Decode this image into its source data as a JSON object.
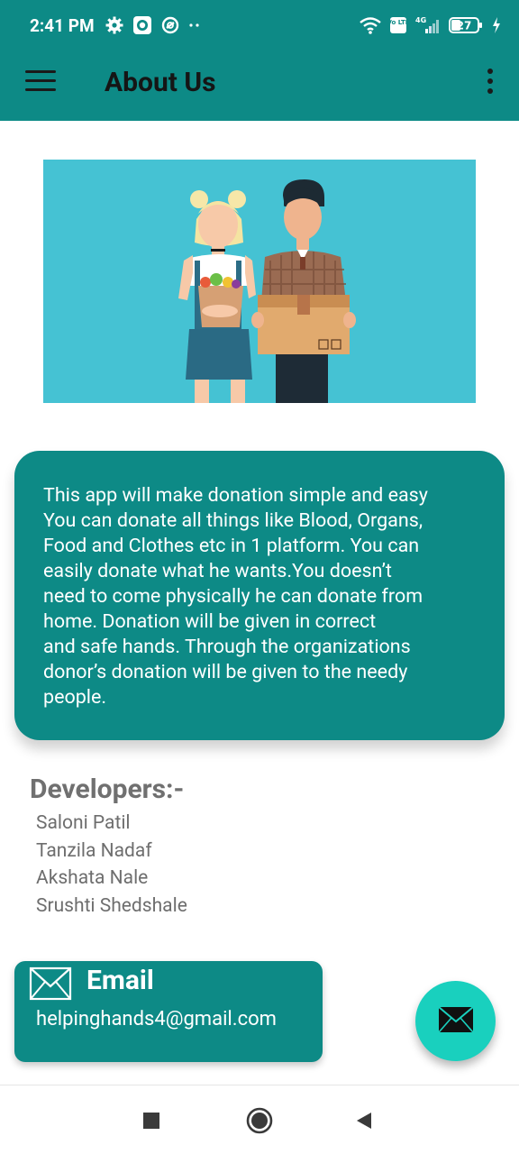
{
  "status_bar": {
    "time": "2:41 PM",
    "network_label": "4G",
    "volte_label": "Vo LTE",
    "battery": "27"
  },
  "app_bar": {
    "title": "About Us"
  },
  "about": {
    "text": "This app will make donation simple and easy\nYou can donate all things like Blood, Organs,\nFood and Clothes etc in 1 platform.  You can\neasily donate what he wants.You doesn’t\nneed to come physically he can donate from\nhome. Donation will be given in correct\nand safe hands. Through the organizations\ndonor’s donation will be given to the needy\npeople."
  },
  "developers": {
    "title": "Developers:-",
    "names": [
      "Saloni Patil",
      "Tanzila Nadaf",
      "Akshata Nale",
      "Srushti Shedshale"
    ]
  },
  "email": {
    "title": "Email",
    "address": "helpinghands4@gmail.com"
  },
  "colors": {
    "primary": "#0d8a86",
    "fab": "#19d0be",
    "hero_bg": "#45c2d3"
  },
  "icons": {
    "menu": "hamburger-menu-icon",
    "overflow": "more-vert-icon",
    "email": "envelope-icon",
    "fab": "envelope-icon",
    "nav_recents": "square-icon",
    "nav_home": "circle-icon",
    "nav_back": "triangle-back-icon"
  }
}
